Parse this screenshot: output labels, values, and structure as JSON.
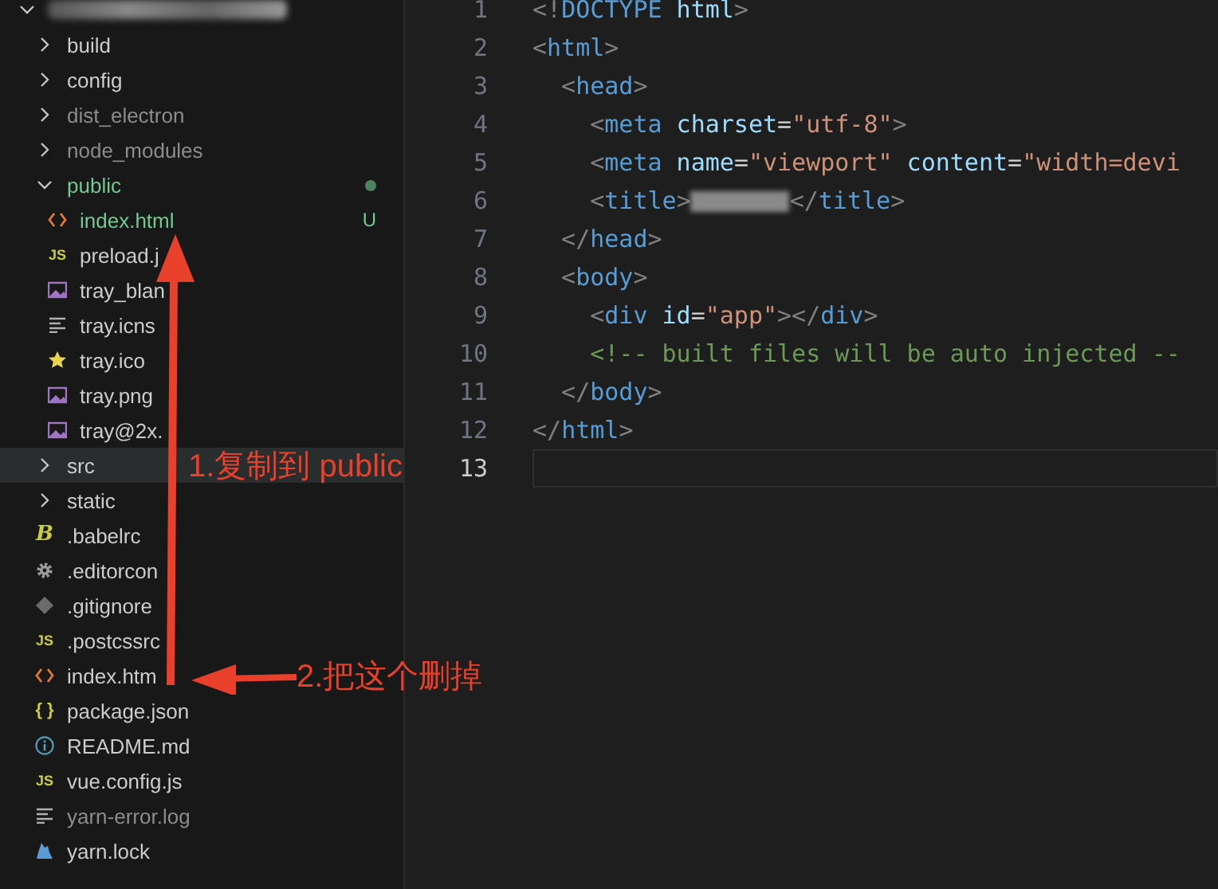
{
  "explorer": {
    "root": {
      "expanded": true
    },
    "items": [
      {
        "name": "build",
        "kind": "folder",
        "expanded": false,
        "ignored": false,
        "untracked": false,
        "highlighted": false
      },
      {
        "name": "config",
        "kind": "folder",
        "expanded": false,
        "ignored": false,
        "untracked": false,
        "highlighted": false
      },
      {
        "name": "dist_electron",
        "kind": "folder",
        "expanded": false,
        "ignored": true,
        "untracked": false,
        "highlighted": false
      },
      {
        "name": "node_modules",
        "kind": "folder",
        "expanded": false,
        "ignored": true,
        "untracked": false,
        "highlighted": false
      },
      {
        "name": "public",
        "kind": "folder",
        "expanded": true,
        "ignored": false,
        "untracked": true,
        "highlighted": false,
        "changes_dot": true,
        "children": [
          {
            "name": "index.html",
            "kind": "html",
            "ignored": false,
            "untracked": true,
            "highlighted": false,
            "badge": "U"
          },
          {
            "name": "preload.j",
            "kind": "js",
            "icon_text": "JS",
            "ignored": false,
            "untracked": false,
            "highlighted": false
          },
          {
            "name": "tray_blan",
            "kind": "image",
            "ignored": false,
            "untracked": false,
            "highlighted": false
          },
          {
            "name": "tray.icns",
            "kind": "lines",
            "ignored": false,
            "untracked": false,
            "highlighted": false
          },
          {
            "name": "tray.ico",
            "kind": "star",
            "ignored": false,
            "untracked": false,
            "highlighted": false
          },
          {
            "name": "tray.png",
            "kind": "image",
            "ignored": false,
            "untracked": false,
            "highlighted": false
          },
          {
            "name": "tray@2x.",
            "kind": "image",
            "ignored": false,
            "untracked": false,
            "highlighted": false
          }
        ]
      },
      {
        "name": "src",
        "kind": "folder",
        "expanded": false,
        "ignored": false,
        "untracked": false,
        "highlighted": true
      },
      {
        "name": "static",
        "kind": "folder",
        "expanded": false,
        "ignored": false,
        "untracked": false,
        "highlighted": false
      },
      {
        "name": ".babelrc",
        "kind": "babel",
        "icon_text": "B",
        "ignored": false,
        "untracked": false,
        "highlighted": false
      },
      {
        "name": ".editorcon",
        "kind": "gear",
        "ignored": false,
        "untracked": false,
        "highlighted": false
      },
      {
        "name": ".gitignore",
        "kind": "git",
        "ignored": false,
        "untracked": false,
        "highlighted": false
      },
      {
        "name": ".postcssrc",
        "kind": "js",
        "icon_text": "JS",
        "ignored": false,
        "untracked": false,
        "highlighted": false
      },
      {
        "name": "index.htm",
        "kind": "html",
        "ignored": false,
        "untracked": false,
        "highlighted": false
      },
      {
        "name": "package.json",
        "kind": "json",
        "icon_text": "{ }",
        "ignored": false,
        "untracked": false,
        "highlighted": false
      },
      {
        "name": "README.md",
        "kind": "info",
        "ignored": false,
        "untracked": false,
        "highlighted": false
      },
      {
        "name": "vue.config.js",
        "kind": "js",
        "icon_text": "JS",
        "ignored": false,
        "untracked": false,
        "highlighted": false
      },
      {
        "name": "yarn-error.log",
        "kind": "lines",
        "ignored": true,
        "untracked": false,
        "highlighted": false
      },
      {
        "name": "yarn.lock",
        "kind": "yarn",
        "ignored": false,
        "untracked": false,
        "highlighted": false
      }
    ]
  },
  "editor": {
    "lines": [
      {
        "number": "1",
        "current": false,
        "tokens": [
          {
            "kind": "punct",
            "text": "<!"
          },
          {
            "kind": "tag",
            "text": "DOCTYPE"
          },
          {
            "kind": "attr",
            "text": " html"
          },
          {
            "kind": "punct",
            "text": ">"
          }
        ]
      },
      {
        "number": "2",
        "current": false,
        "tokens": [
          {
            "kind": "punct",
            "text": "<"
          },
          {
            "kind": "tag",
            "text": "html"
          },
          {
            "kind": "punct",
            "text": ">"
          }
        ]
      },
      {
        "number": "3",
        "current": false,
        "tokens": [
          {
            "kind": "punct",
            "text": "  <"
          },
          {
            "kind": "tag",
            "text": "head"
          },
          {
            "kind": "punct",
            "text": ">"
          }
        ]
      },
      {
        "number": "4",
        "current": false,
        "tokens": [
          {
            "kind": "punct",
            "text": "    <"
          },
          {
            "kind": "tag",
            "text": "meta"
          },
          {
            "kind": "attr",
            "text": " charset"
          },
          {
            "kind": "plain",
            "text": "="
          },
          {
            "kind": "string",
            "text": "\"utf-8\""
          },
          {
            "kind": "punct",
            "text": ">"
          }
        ]
      },
      {
        "number": "5",
        "current": false,
        "tokens": [
          {
            "kind": "punct",
            "text": "    <"
          },
          {
            "kind": "tag",
            "text": "meta"
          },
          {
            "kind": "attr",
            "text": " name"
          },
          {
            "kind": "plain",
            "text": "="
          },
          {
            "kind": "string",
            "text": "\"viewport\""
          },
          {
            "kind": "attr",
            "text": " content"
          },
          {
            "kind": "plain",
            "text": "="
          },
          {
            "kind": "string",
            "text": "\"width=devi"
          }
        ]
      },
      {
        "number": "6",
        "current": false,
        "tokens": [
          {
            "kind": "punct",
            "text": "    <"
          },
          {
            "kind": "tag",
            "text": "title"
          },
          {
            "kind": "punct",
            "text": ">"
          },
          {
            "kind": "redacted"
          },
          {
            "kind": "punct",
            "text": "</"
          },
          {
            "kind": "tag",
            "text": "title"
          },
          {
            "kind": "punct",
            "text": ">"
          }
        ]
      },
      {
        "number": "7",
        "current": false,
        "tokens": [
          {
            "kind": "punct",
            "text": "  </"
          },
          {
            "kind": "tag",
            "text": "head"
          },
          {
            "kind": "punct",
            "text": ">"
          }
        ]
      },
      {
        "number": "8",
        "current": false,
        "tokens": [
          {
            "kind": "punct",
            "text": "  <"
          },
          {
            "kind": "tag",
            "text": "body"
          },
          {
            "kind": "punct",
            "text": ">"
          }
        ]
      },
      {
        "number": "9",
        "current": false,
        "tokens": [
          {
            "kind": "punct",
            "text": "    <"
          },
          {
            "kind": "tag",
            "text": "div"
          },
          {
            "kind": "attr",
            "text": " id"
          },
          {
            "kind": "plain",
            "text": "="
          },
          {
            "kind": "string",
            "text": "\"app\""
          },
          {
            "kind": "punct",
            "text": "></"
          },
          {
            "kind": "tag",
            "text": "div"
          },
          {
            "kind": "punct",
            "text": ">"
          }
        ]
      },
      {
        "number": "10",
        "current": false,
        "tokens": [
          {
            "kind": "comment",
            "text": "    <!-- built files will be auto injected --"
          }
        ]
      },
      {
        "number": "11",
        "current": false,
        "tokens": [
          {
            "kind": "punct",
            "text": "  </"
          },
          {
            "kind": "tag",
            "text": "body"
          },
          {
            "kind": "punct",
            "text": ">"
          }
        ]
      },
      {
        "number": "12",
        "current": false,
        "tokens": [
          {
            "kind": "punct",
            "text": "</"
          },
          {
            "kind": "tag",
            "text": "html"
          },
          {
            "kind": "punct",
            "text": ">"
          }
        ]
      },
      {
        "number": "13",
        "current": true
      }
    ]
  },
  "annotations": [
    {
      "text": "1.复制到 public",
      "kind": "up"
    },
    {
      "text": "2.把这个删掉",
      "kind": "left"
    }
  ]
}
